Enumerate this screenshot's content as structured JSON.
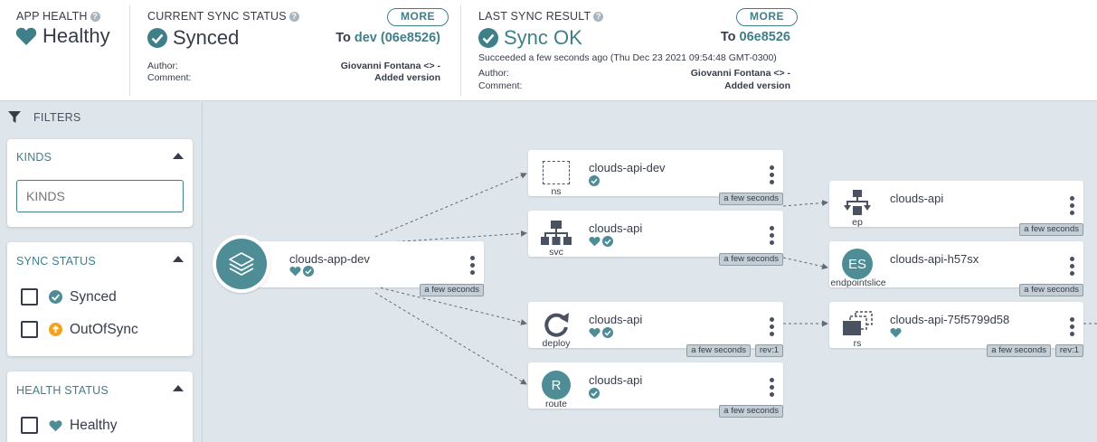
{
  "colors": {
    "accent": "#3f7f8a",
    "synced": "#4e8d96",
    "out_of_sync": "#f4a11e",
    "background": "#dee6eb"
  },
  "app_health": {
    "label": "APP HEALTH",
    "status": "Healthy",
    "icon": "heart-icon"
  },
  "current_sync": {
    "label": "CURRENT SYNC STATUS",
    "status": "Synced",
    "more_label": "MORE",
    "to_prefix": "To",
    "to_revision": "dev (06e8526)",
    "author_label": "Author:",
    "author_value": "Giovanni Fontana <> -",
    "comment_label": "Comment:",
    "comment_value": "Added version"
  },
  "last_sync": {
    "label": "LAST SYNC RESULT",
    "status": "Sync OK",
    "more_label": "MORE",
    "to_prefix": "To",
    "to_revision": "06e8526",
    "succeeded_text": "Succeeded a few seconds ago (Thu Dec 23 2021 09:54:48 GMT-0300)",
    "author_label": "Author:",
    "author_value": "Giovanni Fontana <> -",
    "comment_label": "Comment:",
    "comment_value": "Added version"
  },
  "filters": {
    "title": "FILTERS",
    "kinds": {
      "title": "KINDS",
      "placeholder": "KINDS"
    },
    "sync_status": {
      "title": "SYNC STATUS",
      "options": [
        {
          "label": "Synced",
          "icon": "check-circle-icon"
        },
        {
          "label": "OutOfSync",
          "icon": "arrow-up-circle-icon"
        }
      ]
    },
    "health_status": {
      "title": "HEALTH STATUS",
      "options": [
        {
          "label": "Healthy",
          "icon": "heart-icon"
        }
      ]
    }
  },
  "graph": {
    "app": {
      "name": "clouds-app-dev",
      "age": "a few seconds"
    },
    "nodes": {
      "ns": {
        "kind": "ns",
        "name": "clouds-api-dev",
        "age": "a few seconds"
      },
      "svc": {
        "kind": "svc",
        "name": "clouds-api",
        "age": "a few seconds"
      },
      "deploy": {
        "kind": "deploy",
        "name": "clouds-api",
        "age": "a few seconds",
        "rev": "rev:1"
      },
      "route": {
        "kind": "route",
        "name": "clouds-api",
        "age": "a few seconds",
        "icon_letter": "R"
      },
      "ep": {
        "kind": "ep",
        "name": "clouds-api",
        "age": "a few seconds"
      },
      "endpointslice": {
        "kind": "endpointslice",
        "name": "clouds-api-h57sx",
        "age": "a few seconds",
        "icon_letters": "ES"
      },
      "rs": {
        "kind": "rs",
        "name": "clouds-api-75f5799d58",
        "age": "a few seconds",
        "rev": "rev:1"
      }
    }
  }
}
